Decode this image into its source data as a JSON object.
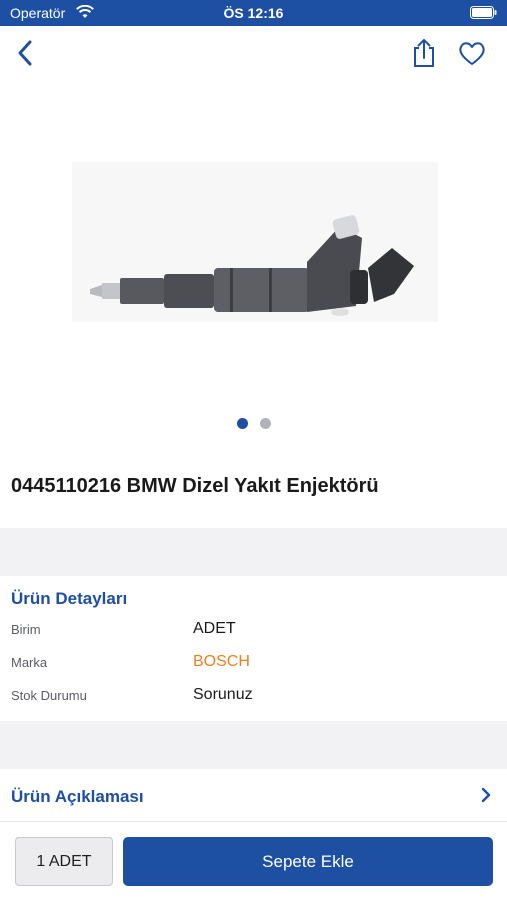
{
  "status": {
    "carrier": "Operatör",
    "time": "ÖS 12:16"
  },
  "nav": {
    "back_icon": "chevron-left-icon",
    "share_icon": "share-icon",
    "favorite_icon": "heart-icon"
  },
  "gallery": {
    "image": "fuel-injector-photo",
    "page_count": 2,
    "current_page": 1
  },
  "product": {
    "title": "0445110216 BMW Dizel Yakıt Enjektörü"
  },
  "details": {
    "heading": "Ürün Detayları",
    "rows": [
      {
        "label": "Birim",
        "value": "ADET"
      },
      {
        "label": "Marka",
        "value": "BOSCH"
      },
      {
        "label": "Stok Durumu",
        "value": "Sorunuz"
      }
    ]
  },
  "description": {
    "heading": "Ürün Açıklaması"
  },
  "footer": {
    "quantity": "1 ADET",
    "add_to_cart": "Sepete Ekle"
  },
  "colors": {
    "primary": "#1d4fa3",
    "brand": "#f07f1e",
    "section_bg": "#f2f2f4"
  }
}
